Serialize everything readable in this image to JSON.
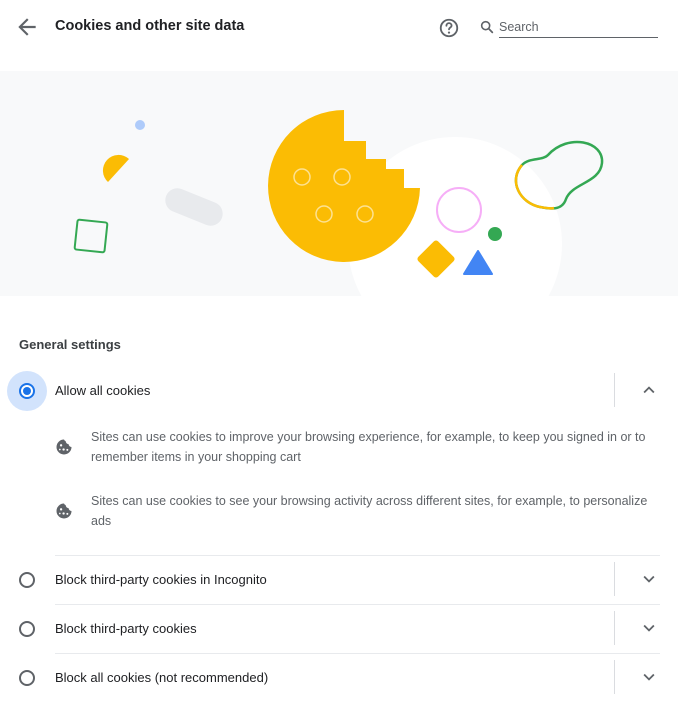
{
  "header": {
    "title": "Cookies and other site data",
    "back_icon": "arrow-back-icon",
    "help_icon": "help-icon",
    "search": {
      "icon": "search-icon",
      "placeholder": "Search",
      "value": ""
    }
  },
  "banner": {
    "description": "cookie-illustration",
    "accent": "#fbbc04",
    "colors": [
      "#fbbc04",
      "#34a853",
      "#4285f4",
      "#f28b82",
      "#aecbfa",
      "#e8eaed"
    ]
  },
  "general_settings": {
    "heading": "General settings",
    "options": [
      {
        "label": "Allow all cookies",
        "selected": true,
        "expanded": true,
        "descriptions": [
          {
            "icon": "cookie-icon",
            "text": "Sites can use cookies to improve your browsing experience, for example, to keep you signed in or to remember items in your shopping cart"
          },
          {
            "icon": "cookie-icon",
            "text": "Sites can use cookies to see your browsing activity across different sites, for example, to personalize ads"
          }
        ]
      },
      {
        "label": "Block third-party cookies in Incognito",
        "selected": false,
        "expanded": false
      },
      {
        "label": "Block third-party cookies",
        "selected": false,
        "expanded": false
      },
      {
        "label": "Block all cookies (not recommended)",
        "selected": false,
        "expanded": false
      }
    ]
  },
  "colors": {
    "accent": "#1a73e8",
    "radio_halo": "#d2e3fc",
    "text_primary": "#202124",
    "text_secondary": "#5f6368"
  }
}
